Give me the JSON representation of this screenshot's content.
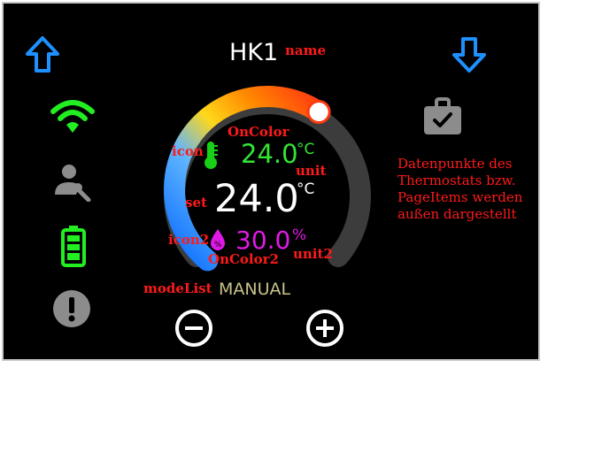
{
  "device": {
    "name": "HK1",
    "target_temp": "24.0",
    "target_unit": "°C",
    "actual_temp": "24.0",
    "actual_unit": "°C",
    "humidity": "30.0",
    "humidity_unit": "%",
    "mode": "MANUAL",
    "arc_level_fraction": 0.62
  },
  "annotations": {
    "name": "name",
    "oncolor": "OnColor",
    "icon": "icon",
    "unit": "unit",
    "set": "set",
    "icon2": "icon2",
    "oncolor2": "OnColor2",
    "unit2": "unit2",
    "modelist": "modeList",
    "note": "Datenpunkte des Thermostats bzw. PageItems werden außen dargestellt"
  },
  "icons": {
    "up": "arrow-up-icon",
    "down": "arrow-down-icon",
    "wifi": "wifi-icon",
    "user_tool": "user-wrench-icon",
    "battery": "battery-icon",
    "alert": "alert-icon",
    "briefcase": "briefcase-check-icon",
    "thermometer": "thermometer-icon",
    "humidity": "humidity-drop-icon",
    "minus": "minus-circle-icon",
    "plus": "plus-circle-icon"
  },
  "colors": {
    "background": "#000000",
    "text": "#ffffff",
    "arrow": "#1e90ff",
    "wifi": "#22ee22",
    "battery": "#22ee22",
    "gray_icon": "#8c8c8c",
    "oncolor": "#33e533",
    "oncolor2": "#e01ae6",
    "thermometer": "#18d018",
    "humidity_icon": "#e01ae6",
    "mode": "#c8c28a",
    "annotation": "#ff1a1a"
  }
}
